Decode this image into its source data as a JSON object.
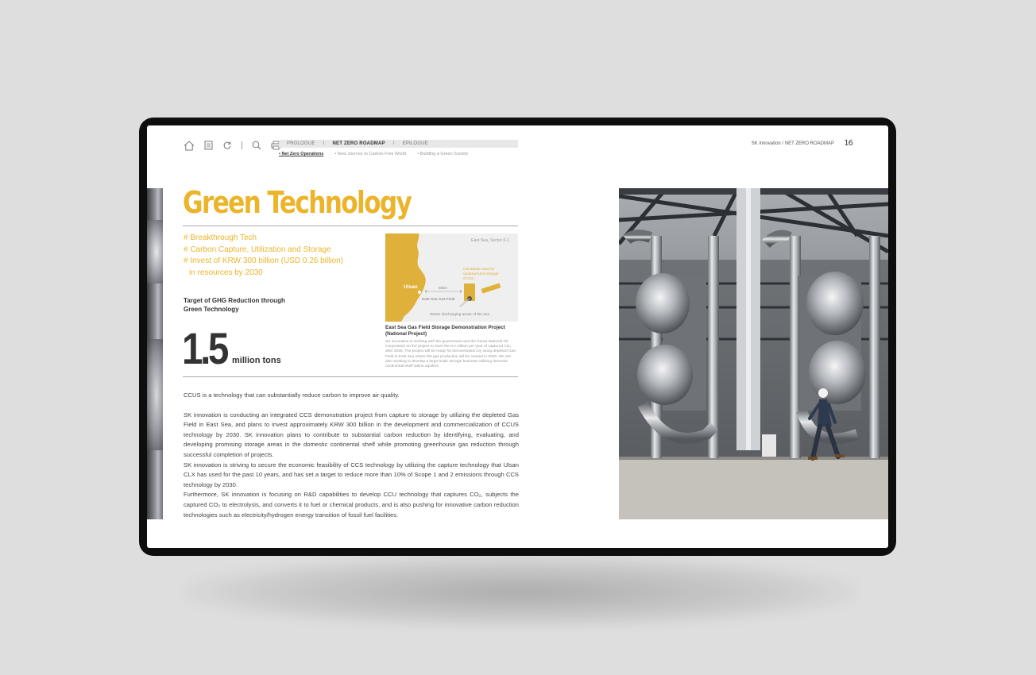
{
  "toolbar": {
    "icons": [
      "home-icon",
      "list-icon",
      "refresh-icon",
      "search-icon",
      "print-icon"
    ]
  },
  "menu": {
    "items": [
      {
        "label": "PROLOGUE"
      },
      {
        "label": "NET ZERO ROADMAP"
      },
      {
        "label": "EPILOGUE"
      }
    ],
    "separator": "I",
    "active_index": 1
  },
  "submenu": {
    "items": [
      {
        "label": "• Net Zero Operations"
      },
      {
        "label": "• New Journey to Carbon Free World"
      },
      {
        "label": "• Building a Green Society"
      }
    ],
    "active_index": 0
  },
  "header": {
    "breadcrumb": "SK innovation / NET ZERO ROADMAP",
    "page_number": "16"
  },
  "content": {
    "title": "Green Technology",
    "tags": [
      "# Breakthrough Tech",
      "# Carbon Capture, Utilization and Storage",
      "# Invest of KRW 300 billion (USD 0.26 billion)",
      "in resources by 2030"
    ],
    "target_label_line1": "Target of GHG Reduction through",
    "target_label_line2": "Green Technology",
    "big_number": "1.5",
    "big_unit": "million tons",
    "map": {
      "region_label": "East Sea, Sector 6-1",
      "city_label": "Ulsan",
      "distance_label": "60km",
      "field_label": "East Sea Gas Field",
      "candidate_label_1": "Candidate area for",
      "candidate_label_2": "underground storage",
      "candidate_label_3": "of CO₂",
      "waste_label": "Waste discharging areas of the sea"
    },
    "map_caption_title": "East Sea Gas Field Storage Demonstration Project (National Project)",
    "map_caption_body": "SK innovation is working with the government and the Korea National Oil Corporation on the project to store the 0.4 million per year of captured CO₂ after 2025. The project will be ready for demonstration by using depleted Gas Field in East Sea where the gas production will be ceased in 2025. We are also seeking to develop a large-scale storage business utilizing domestic continental shelf saline aquifers.",
    "paragraphs": [
      "CCUS is a technology that can substantially reduce carbon to improve air quality.",
      "SK innovation is conducting an integrated CCS demonstration project from capture to storage by utilizing the depleted Gas Field in East Sea, and plans to invest approximately KRW 300 billion in the development and commercialization of CCUS technology by 2030. SK innovation plans to contribute to substantial carbon reduction by identifying, evaluating, and developing promising storage areas in the domestic continental shelf while promoting greenhouse gas reduction through successful completion of projects.",
      "SK innovation is striving to secure the economic feasibility of CCS technology by utilizing the capture technology that Ulsan CLX has used for the past 10 years, and has set a target to reduce more than 10% of Scope 1 and 2 emissions through CCS technology by 2030.",
      "Furthermore, SK innovation is focusing on R&D capabilities to develop CCU technology that captures CO₂, subjects the captured CO₂ to electrolysis, and converts it to fuel or chemical products, and is also pushing for innovative carbon reduction technologies such as electricity/hydrogen energy transition of fossil fuel facilities."
    ]
  },
  "colors": {
    "accent": "#ecb42a",
    "device_frame": "#0e0e0e",
    "background": "#dedede"
  }
}
